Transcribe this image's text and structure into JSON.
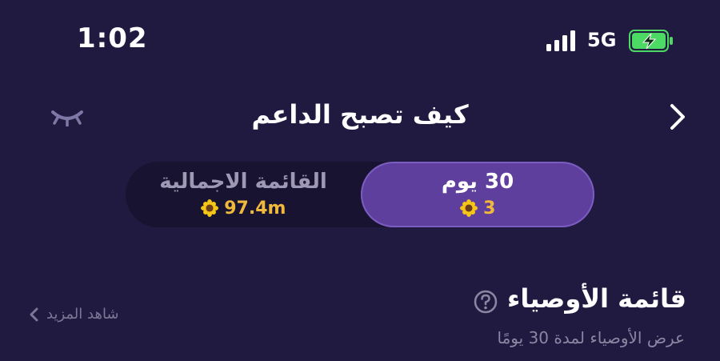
{
  "status_bar": {
    "time": "1:02",
    "network": "5G"
  },
  "header": {
    "title": "كيف تصبح الداعم"
  },
  "tabs": [
    {
      "label": "30 يوم",
      "value": "3",
      "active": true
    },
    {
      "label": "القائمة الاجمالية",
      "value": "97.4m",
      "active": false
    }
  ],
  "section": {
    "title": "قائمة الأوصياء",
    "subtitle": "عرض الأوصياء لمدة 30 يومًا",
    "see_more": "شاهد المزيد"
  },
  "icons": {
    "signal": "signal-bars-icon",
    "battery": "battery-charging-icon",
    "hide": "eye-closed-icon",
    "back": "chevron-right-icon",
    "help": "question-circle-icon",
    "coin": "sunflower-icon",
    "see_more_arrow": "chevron-left-icon"
  },
  "colors": {
    "background": "#211a40",
    "active_tab": "#5e3f9e",
    "accent": "#f0b93b",
    "battery": "#4cd964"
  }
}
